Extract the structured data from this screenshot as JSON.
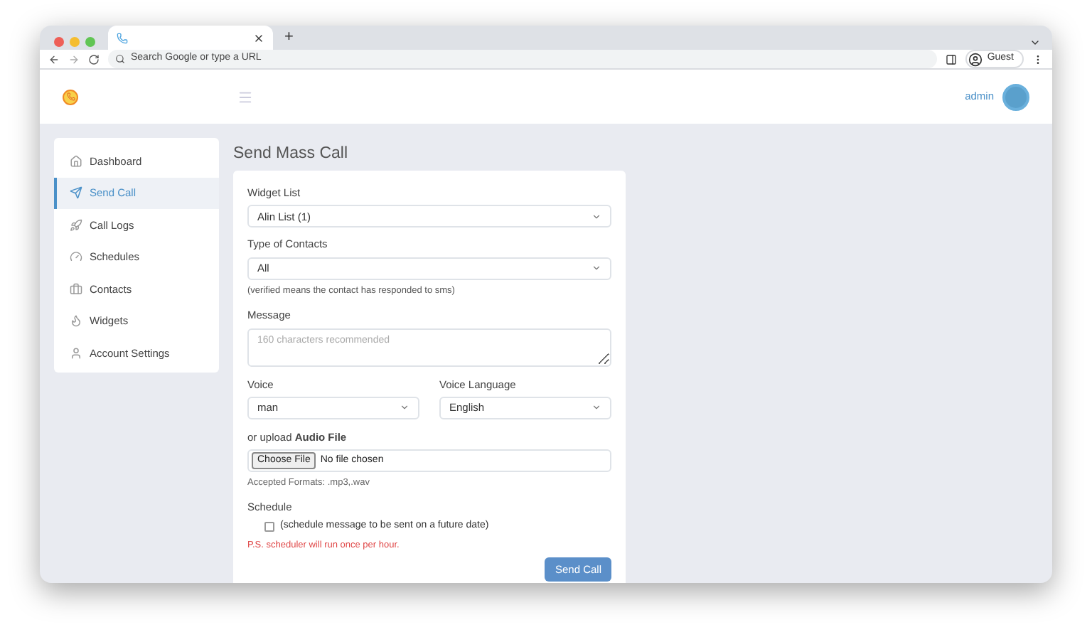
{
  "browser": {
    "address_placeholder": "Search Google or type a URL",
    "profile": "Guest",
    "new_tab": "+"
  },
  "header": {
    "user": "admin"
  },
  "sidebar": {
    "items": [
      {
        "label": "Dashboard",
        "selected": false
      },
      {
        "label": "Send Call",
        "selected": true
      },
      {
        "label": "Call Logs",
        "selected": false
      },
      {
        "label": "Schedules",
        "selected": false
      },
      {
        "label": "Contacts",
        "selected": false
      },
      {
        "label": "Widgets",
        "selected": false
      },
      {
        "label": "Account Settings",
        "selected": false
      }
    ]
  },
  "page_title": "Send Mass Call",
  "form": {
    "widget_list": {
      "label": "Widget List",
      "value": "Alin List (1)"
    },
    "type_of_contacts": {
      "label": "Type of Contacts",
      "value": "All",
      "hint": "(verified means the contact has responded to sms)"
    },
    "message": {
      "label": "Message",
      "placeholder": "160 characters recommended"
    },
    "voice": {
      "label": "Voice",
      "value": "man"
    },
    "voice_language": {
      "label": "Voice Language",
      "value": "English"
    },
    "audio": {
      "label": "or upload **Audio File**",
      "button": "Choose File",
      "status": "No file chosen",
      "hint": "Accepted Formats: .mp3,.wav"
    },
    "schedule": {
      "label": "Schedule",
      "checkbox_label": "(schedule message to be sent on a future date)",
      "checked": false,
      "warning": "P.S. scheduler will run once per hour."
    },
    "submit": "Send Call"
  }
}
